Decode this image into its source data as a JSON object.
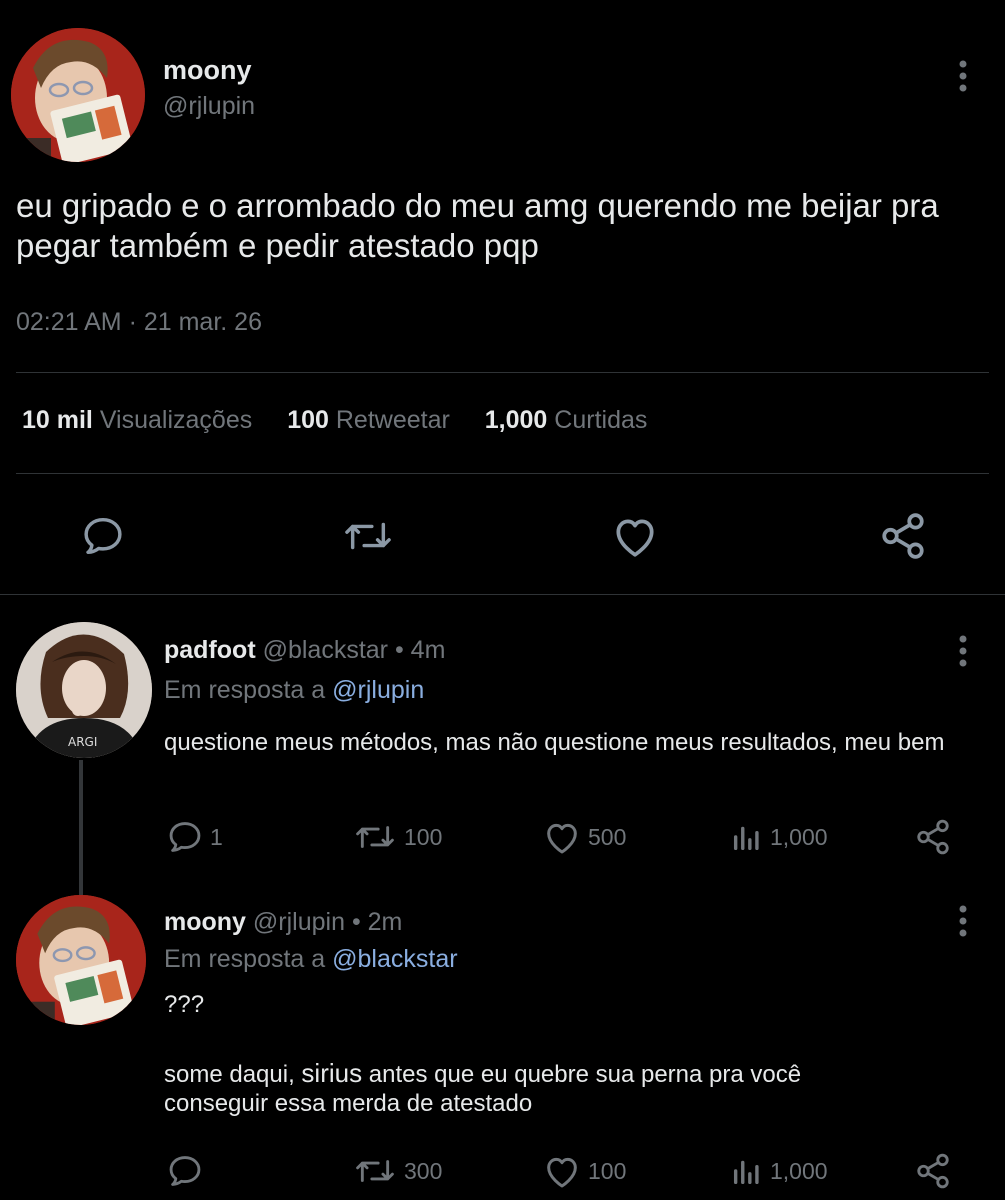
{
  "main_tweet": {
    "display_name": "moony",
    "handle": "@rjlupin",
    "text": "eu gripado e o arrombado do meu amg querendo me beijar pra pegar também e pedir atestado pqp",
    "timestamp": "02:21 AM · 21 mar. 26",
    "stats": {
      "views_count": "10 mil",
      "views_label": "Visualizações",
      "retweets_count": "100",
      "retweets_label": "Retweetar",
      "likes_count": "1,000",
      "likes_label": "Curtidas"
    },
    "actions": [
      "reply-icon",
      "retweet-icon",
      "like-icon",
      "share-icon"
    ]
  },
  "replies": [
    {
      "display_name": "padfoot",
      "handle": "@blackstar",
      "time": "• 4m",
      "in_reply_prefix": "Em resposta a",
      "in_reply_to": "@rjlupin",
      "text": "questione meus métodos, mas não questione meus resultados, meu bem",
      "replies_count": "1",
      "retweets_count": "100",
      "likes_count": "500",
      "views_count": "1,000"
    },
    {
      "display_name": "moony",
      "handle": "@rjlupin",
      "time": "• 2m",
      "in_reply_prefix": "Em resposta a",
      "in_reply_to": "@blackstar",
      "text_line1": "???",
      "text_line2_a": "some daqui,",
      "text_line2_name": "sirius",
      "text_line2_b": "antes que eu quebre sua perna pra você",
      "text_line3": "conseguir essa merda de atestado",
      "replies_count": "",
      "retweets_count": "300",
      "likes_count": "100",
      "views_count": "1,000"
    }
  ],
  "colors": {
    "background": "#000000",
    "text": "#e7e9ea",
    "muted": "#71767b",
    "mention": "#8aaee0",
    "divider": "#2f3336"
  }
}
